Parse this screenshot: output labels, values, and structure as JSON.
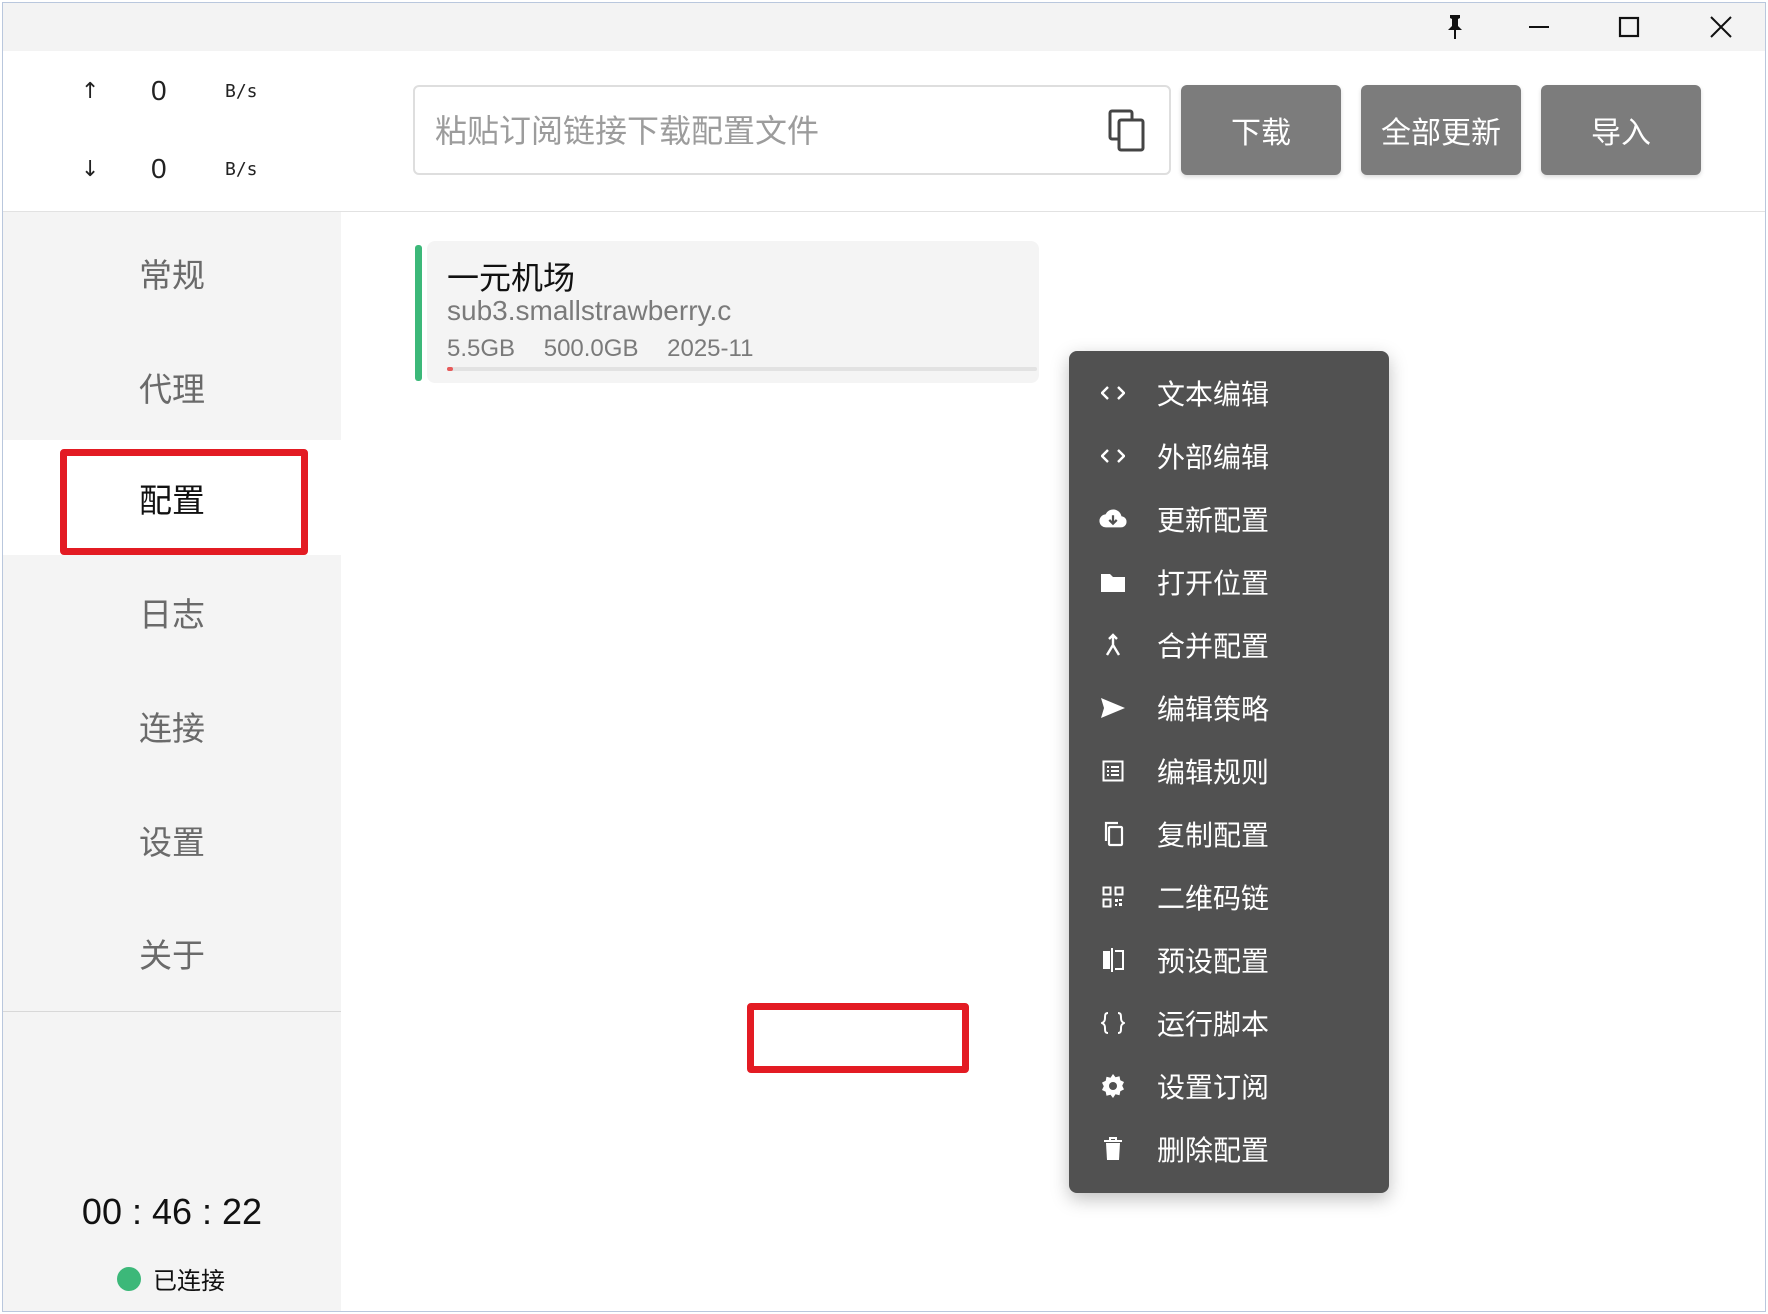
{
  "window": {
    "controls": [
      "pin-icon",
      "minimize-icon",
      "maximize-icon",
      "close-icon"
    ]
  },
  "sidebar": {
    "upload": {
      "arrow": "↑",
      "value": "0",
      "unit": "B/s"
    },
    "download": {
      "arrow": "↓",
      "value": "0",
      "unit": "B/s"
    },
    "items": [
      {
        "label": "常规"
      },
      {
        "label": "代理"
      },
      {
        "label": "配置",
        "active": true
      },
      {
        "label": "日志"
      },
      {
        "label": "连接"
      },
      {
        "label": "设置"
      },
      {
        "label": "关于"
      }
    ],
    "timer": "00 : 46 : 22",
    "status": "已连接",
    "status_color": "#3cb879"
  },
  "toolbar": {
    "url_placeholder": "粘贴订阅链接下载配置文件",
    "url_value": "",
    "download_label": "下载",
    "update_all_label": "全部更新",
    "import_label": "导入"
  },
  "profile": {
    "name": "一元机场",
    "url": "sub3.smallstrawberry.c",
    "used": "5.5GB",
    "total": "500.0GB",
    "date": "2025-11",
    "usage_fraction": 0.011,
    "accent": "#3cb879"
  },
  "context_menu": {
    "items": [
      {
        "icon": "code-icon",
        "label": "文本编辑"
      },
      {
        "icon": "code-icon",
        "label": "外部编辑"
      },
      {
        "icon": "cloud-download-icon",
        "label": "更新配置"
      },
      {
        "icon": "folder-icon",
        "label": "打开位置"
      },
      {
        "icon": "merge-icon",
        "label": "合并配置"
      },
      {
        "icon": "send-icon",
        "label": "编辑策略"
      },
      {
        "icon": "list-icon",
        "label": "编辑规则"
      },
      {
        "icon": "copy-icon",
        "label": "复制配置"
      },
      {
        "icon": "qrcode-icon",
        "label": "二维码链"
      },
      {
        "icon": "compare-icon",
        "label": "预设配置"
      },
      {
        "icon": "braces-icon",
        "label": "运行脚本"
      },
      {
        "icon": "gear-icon",
        "label": "设置订阅",
        "highlighted": true
      },
      {
        "icon": "trash-icon",
        "label": "删除配置"
      }
    ]
  },
  "highlight_color": "#e31b23"
}
